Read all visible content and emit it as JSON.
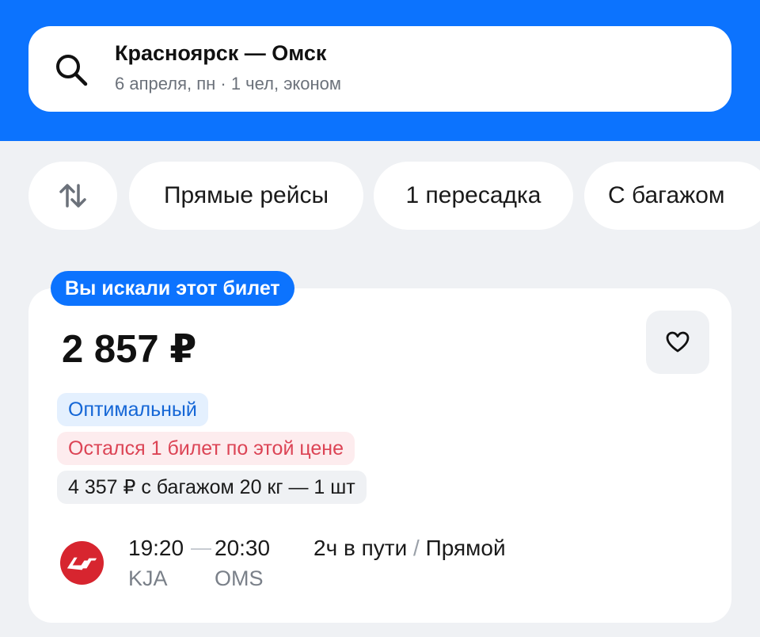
{
  "header": {
    "route": "Красноярск — Омск",
    "subtitle": "6 апреля, пн · 1 чел, эконом",
    "icon": "search-icon"
  },
  "filters": {
    "sort_icon": "sort-arrows-icon",
    "chips": [
      "Прямые рейсы",
      "1 пересадка",
      "С багажом"
    ]
  },
  "ticket": {
    "searched_label": "Вы искали этот билет",
    "price": "2 857 ₽",
    "favorite_icon": "heart-icon",
    "badges": {
      "optimal": "Оптимальный",
      "last_ticket": "Остался 1 билет по этой цене",
      "baggage": "4 357 ₽ с багажом 20 кг — 1 шт"
    },
    "airline_icon": "nordwind-logo-icon",
    "departure_time": "19:20",
    "arrival_time": "20:30",
    "departure_code": "KJA",
    "arrival_code": "OMS",
    "duration": "2ч в пути",
    "separator": "/",
    "stops": "Прямой"
  },
  "colors": {
    "accent": "#0c73fe",
    "background": "#eff1f4",
    "optimal_text": "#1466d6",
    "warning_text": "#dc4455",
    "airline_red": "#d7252f"
  }
}
